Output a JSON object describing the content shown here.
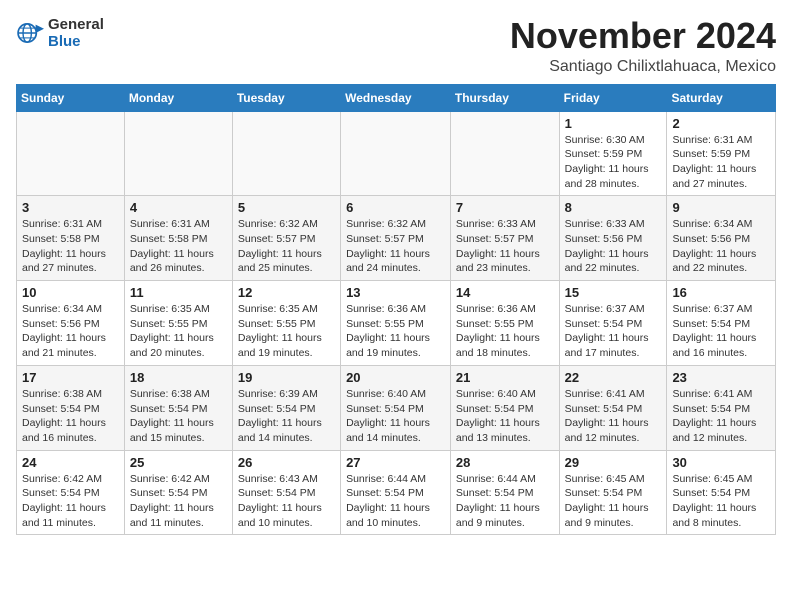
{
  "header": {
    "logo": {
      "general": "General",
      "blue": "Blue"
    },
    "title": "November 2024",
    "location": "Santiago Chilixtlahuaca, Mexico"
  },
  "weekdays": [
    "Sunday",
    "Monday",
    "Tuesday",
    "Wednesday",
    "Thursday",
    "Friday",
    "Saturday"
  ],
  "weeks": [
    [
      {
        "day": "",
        "info": ""
      },
      {
        "day": "",
        "info": ""
      },
      {
        "day": "",
        "info": ""
      },
      {
        "day": "",
        "info": ""
      },
      {
        "day": "",
        "info": ""
      },
      {
        "day": "1",
        "info": "Sunrise: 6:30 AM\nSunset: 5:59 PM\nDaylight: 11 hours and 28 minutes."
      },
      {
        "day": "2",
        "info": "Sunrise: 6:31 AM\nSunset: 5:59 PM\nDaylight: 11 hours and 27 minutes."
      }
    ],
    [
      {
        "day": "3",
        "info": "Sunrise: 6:31 AM\nSunset: 5:58 PM\nDaylight: 11 hours and 27 minutes."
      },
      {
        "day": "4",
        "info": "Sunrise: 6:31 AM\nSunset: 5:58 PM\nDaylight: 11 hours and 26 minutes."
      },
      {
        "day": "5",
        "info": "Sunrise: 6:32 AM\nSunset: 5:57 PM\nDaylight: 11 hours and 25 minutes."
      },
      {
        "day": "6",
        "info": "Sunrise: 6:32 AM\nSunset: 5:57 PM\nDaylight: 11 hours and 24 minutes."
      },
      {
        "day": "7",
        "info": "Sunrise: 6:33 AM\nSunset: 5:57 PM\nDaylight: 11 hours and 23 minutes."
      },
      {
        "day": "8",
        "info": "Sunrise: 6:33 AM\nSunset: 5:56 PM\nDaylight: 11 hours and 22 minutes."
      },
      {
        "day": "9",
        "info": "Sunrise: 6:34 AM\nSunset: 5:56 PM\nDaylight: 11 hours and 22 minutes."
      }
    ],
    [
      {
        "day": "10",
        "info": "Sunrise: 6:34 AM\nSunset: 5:56 PM\nDaylight: 11 hours and 21 minutes."
      },
      {
        "day": "11",
        "info": "Sunrise: 6:35 AM\nSunset: 5:55 PM\nDaylight: 11 hours and 20 minutes."
      },
      {
        "day": "12",
        "info": "Sunrise: 6:35 AM\nSunset: 5:55 PM\nDaylight: 11 hours and 19 minutes."
      },
      {
        "day": "13",
        "info": "Sunrise: 6:36 AM\nSunset: 5:55 PM\nDaylight: 11 hours and 19 minutes."
      },
      {
        "day": "14",
        "info": "Sunrise: 6:36 AM\nSunset: 5:55 PM\nDaylight: 11 hours and 18 minutes."
      },
      {
        "day": "15",
        "info": "Sunrise: 6:37 AM\nSunset: 5:54 PM\nDaylight: 11 hours and 17 minutes."
      },
      {
        "day": "16",
        "info": "Sunrise: 6:37 AM\nSunset: 5:54 PM\nDaylight: 11 hours and 16 minutes."
      }
    ],
    [
      {
        "day": "17",
        "info": "Sunrise: 6:38 AM\nSunset: 5:54 PM\nDaylight: 11 hours and 16 minutes."
      },
      {
        "day": "18",
        "info": "Sunrise: 6:38 AM\nSunset: 5:54 PM\nDaylight: 11 hours and 15 minutes."
      },
      {
        "day": "19",
        "info": "Sunrise: 6:39 AM\nSunset: 5:54 PM\nDaylight: 11 hours and 14 minutes."
      },
      {
        "day": "20",
        "info": "Sunrise: 6:40 AM\nSunset: 5:54 PM\nDaylight: 11 hours and 14 minutes."
      },
      {
        "day": "21",
        "info": "Sunrise: 6:40 AM\nSunset: 5:54 PM\nDaylight: 11 hours and 13 minutes."
      },
      {
        "day": "22",
        "info": "Sunrise: 6:41 AM\nSunset: 5:54 PM\nDaylight: 11 hours and 12 minutes."
      },
      {
        "day": "23",
        "info": "Sunrise: 6:41 AM\nSunset: 5:54 PM\nDaylight: 11 hours and 12 minutes."
      }
    ],
    [
      {
        "day": "24",
        "info": "Sunrise: 6:42 AM\nSunset: 5:54 PM\nDaylight: 11 hours and 11 minutes."
      },
      {
        "day": "25",
        "info": "Sunrise: 6:42 AM\nSunset: 5:54 PM\nDaylight: 11 hours and 11 minutes."
      },
      {
        "day": "26",
        "info": "Sunrise: 6:43 AM\nSunset: 5:54 PM\nDaylight: 11 hours and 10 minutes."
      },
      {
        "day": "27",
        "info": "Sunrise: 6:44 AM\nSunset: 5:54 PM\nDaylight: 11 hours and 10 minutes."
      },
      {
        "day": "28",
        "info": "Sunrise: 6:44 AM\nSunset: 5:54 PM\nDaylight: 11 hours and 9 minutes."
      },
      {
        "day": "29",
        "info": "Sunrise: 6:45 AM\nSunset: 5:54 PM\nDaylight: 11 hours and 9 minutes."
      },
      {
        "day": "30",
        "info": "Sunrise: 6:45 AM\nSunset: 5:54 PM\nDaylight: 11 hours and 8 minutes."
      }
    ]
  ]
}
